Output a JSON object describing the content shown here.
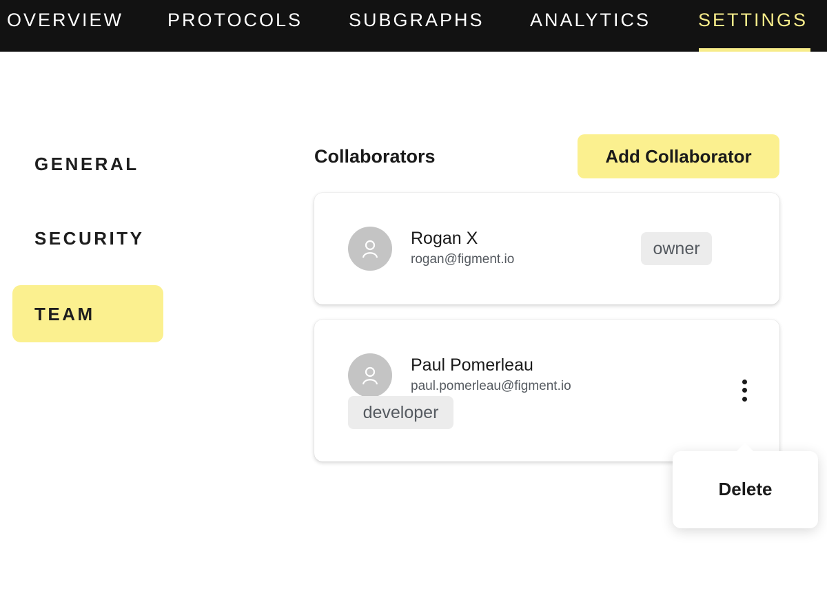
{
  "nav": {
    "items": [
      {
        "label": "OVERVIEW"
      },
      {
        "label": "PROTOCOLS"
      },
      {
        "label": "SUBGRAPHS"
      },
      {
        "label": "ANALYTICS"
      },
      {
        "label": "SETTINGS"
      }
    ],
    "active": "SETTINGS"
  },
  "sidebar": {
    "items": [
      {
        "label": "GENERAL"
      },
      {
        "label": "SECURITY"
      },
      {
        "label": "TEAM"
      }
    ],
    "active": "TEAM"
  },
  "main": {
    "title": "Collaborators",
    "add_button": "Add Collaborator",
    "collaborators": [
      {
        "name": "Rogan X",
        "email": "rogan@figment.io",
        "role": "owner"
      },
      {
        "name": "Paul Pomerleau",
        "email": "paul.pomerleau@figment.io",
        "role": "developer"
      }
    ]
  },
  "menu": {
    "delete_label": "Delete"
  },
  "colors": {
    "accent": "#fbf08f",
    "nav_bg": "#121212"
  }
}
